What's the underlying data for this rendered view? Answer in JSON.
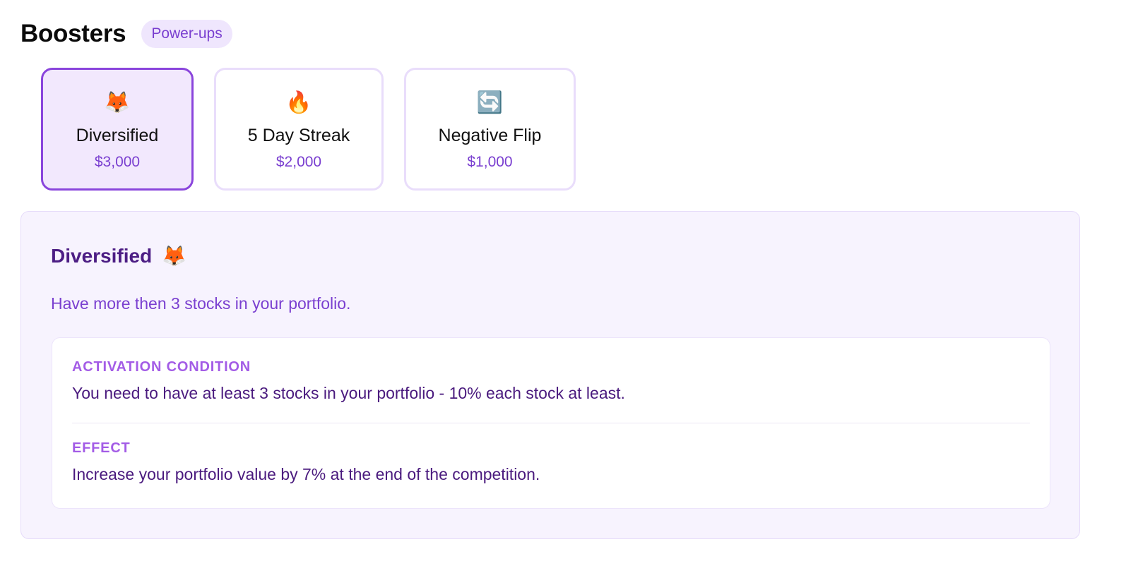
{
  "header": {
    "title": "Boosters",
    "badge": "Power-ups"
  },
  "boosters": [
    {
      "emoji": "🦊",
      "name": "Diversified",
      "price": "$3,000",
      "selected": true
    },
    {
      "emoji": "🔥",
      "name": "5 Day Streak",
      "price": "$2,000",
      "selected": false
    },
    {
      "emoji": "🔄",
      "name": "Negative Flip",
      "price": "$1,000",
      "selected": false
    }
  ],
  "detail": {
    "title": "Diversified",
    "emoji": "🦊",
    "description": "Have more then 3 stocks in your portfolio.",
    "activation_label": "ACTIVATION CONDITION",
    "activation_text": "You need to have at least 3 stocks in your portfolio - 10% each stock at least.",
    "effect_label": "EFFECT",
    "effect_text": "Increase your portfolio value by 7% at the end of the competition."
  },
  "colors": {
    "accent": "#8a45dc",
    "accent_text": "#7a3fd0",
    "dark_purple": "#4c1d84"
  }
}
